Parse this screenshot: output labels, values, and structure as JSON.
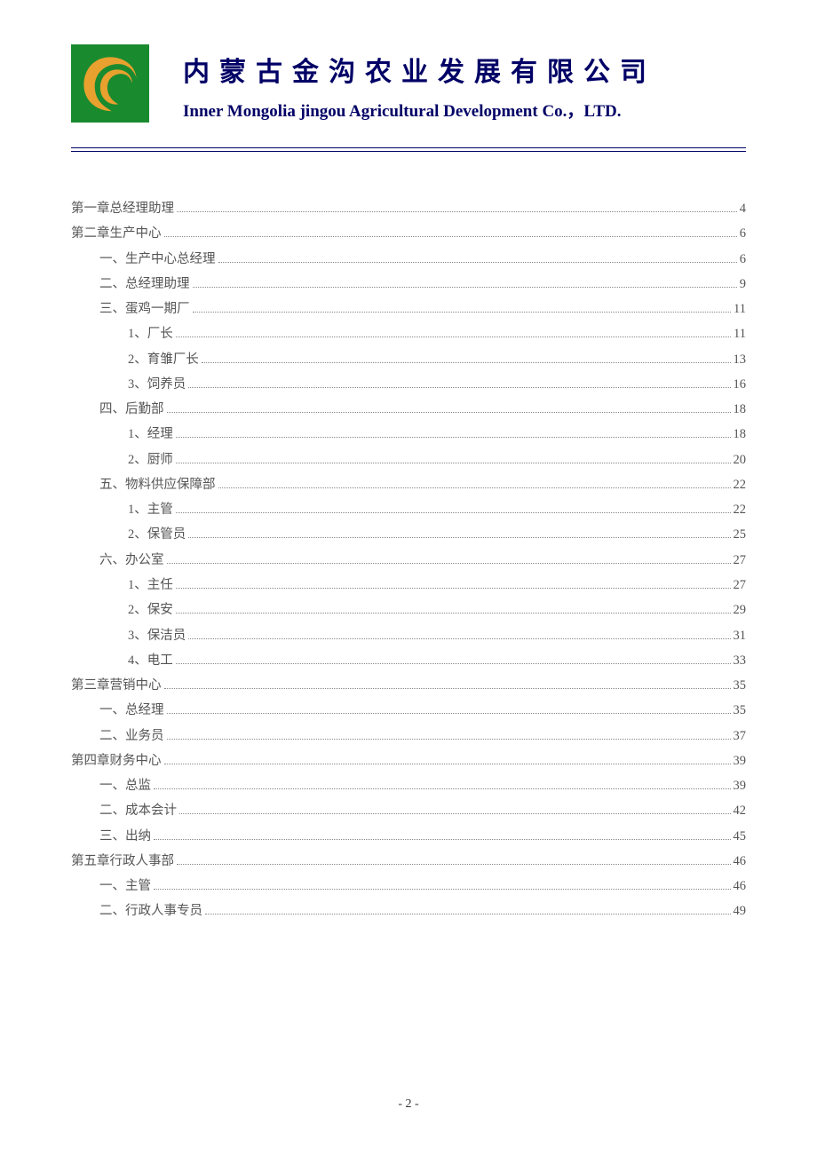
{
  "header": {
    "title_cn": "内蒙古金沟农业发展有限公司",
    "title_en": "Inner Mongolia jingou Agricultural Development Co.，LTD."
  },
  "toc": [
    {
      "label": "第一章总经理助理",
      "page": "4",
      "indent": 0
    },
    {
      "label": "第二章生产中心",
      "page": "6",
      "indent": 0
    },
    {
      "label": "一、生产中心总经理",
      "page": "6",
      "indent": 1
    },
    {
      "label": "二、总经理助理",
      "page": "9",
      "indent": 1
    },
    {
      "label": "三、蛋鸡一期厂",
      "page": "11",
      "indent": 1
    },
    {
      "label": "1、厂长",
      "page": "11",
      "indent": 2
    },
    {
      "label": "2、育雏厂长",
      "page": "13",
      "indent": 2
    },
    {
      "label": "3、饲养员",
      "page": "16",
      "indent": 2
    },
    {
      "label": "四、后勤部",
      "page": "18",
      "indent": 1
    },
    {
      "label": "1、经理",
      "page": "18",
      "indent": 2
    },
    {
      "label": "2、厨师",
      "page": "20",
      "indent": 2
    },
    {
      "label": "五、物料供应保障部",
      "page": "22",
      "indent": 1
    },
    {
      "label": "1、主管",
      "page": "22",
      "indent": 2
    },
    {
      "label": "2、保管员",
      "page": "25",
      "indent": 2
    },
    {
      "label": "六、办公室",
      "page": "27",
      "indent": 1
    },
    {
      "label": "1、主任",
      "page": "27",
      "indent": 2
    },
    {
      "label": "2、保安",
      "page": "29",
      "indent": 2
    },
    {
      "label": "3、保洁员",
      "page": "31",
      "indent": 2
    },
    {
      "label": "4、电工",
      "page": "33",
      "indent": 2
    },
    {
      "label": "第三章营销中心",
      "page": "35",
      "indent": 0
    },
    {
      "label": "一、总经理",
      "page": "35",
      "indent": 1
    },
    {
      "label": "二、业务员",
      "page": "37",
      "indent": 1
    },
    {
      "label": "第四章财务中心",
      "page": "39",
      "indent": 0
    },
    {
      "label": "一、总监",
      "page": "39",
      "indent": 1
    },
    {
      "label": "二、成本会计",
      "page": "42",
      "indent": 1
    },
    {
      "label": "三、出纳",
      "page": "45",
      "indent": 1
    },
    {
      "label": "第五章行政人事部",
      "page": "46",
      "indent": 0
    },
    {
      "label": "一、主管",
      "page": "46",
      "indent": 1
    },
    {
      "label": "二、行政人事专员",
      "page": "49",
      "indent": 1
    }
  ],
  "footer": {
    "page_number": "- 2 -"
  }
}
